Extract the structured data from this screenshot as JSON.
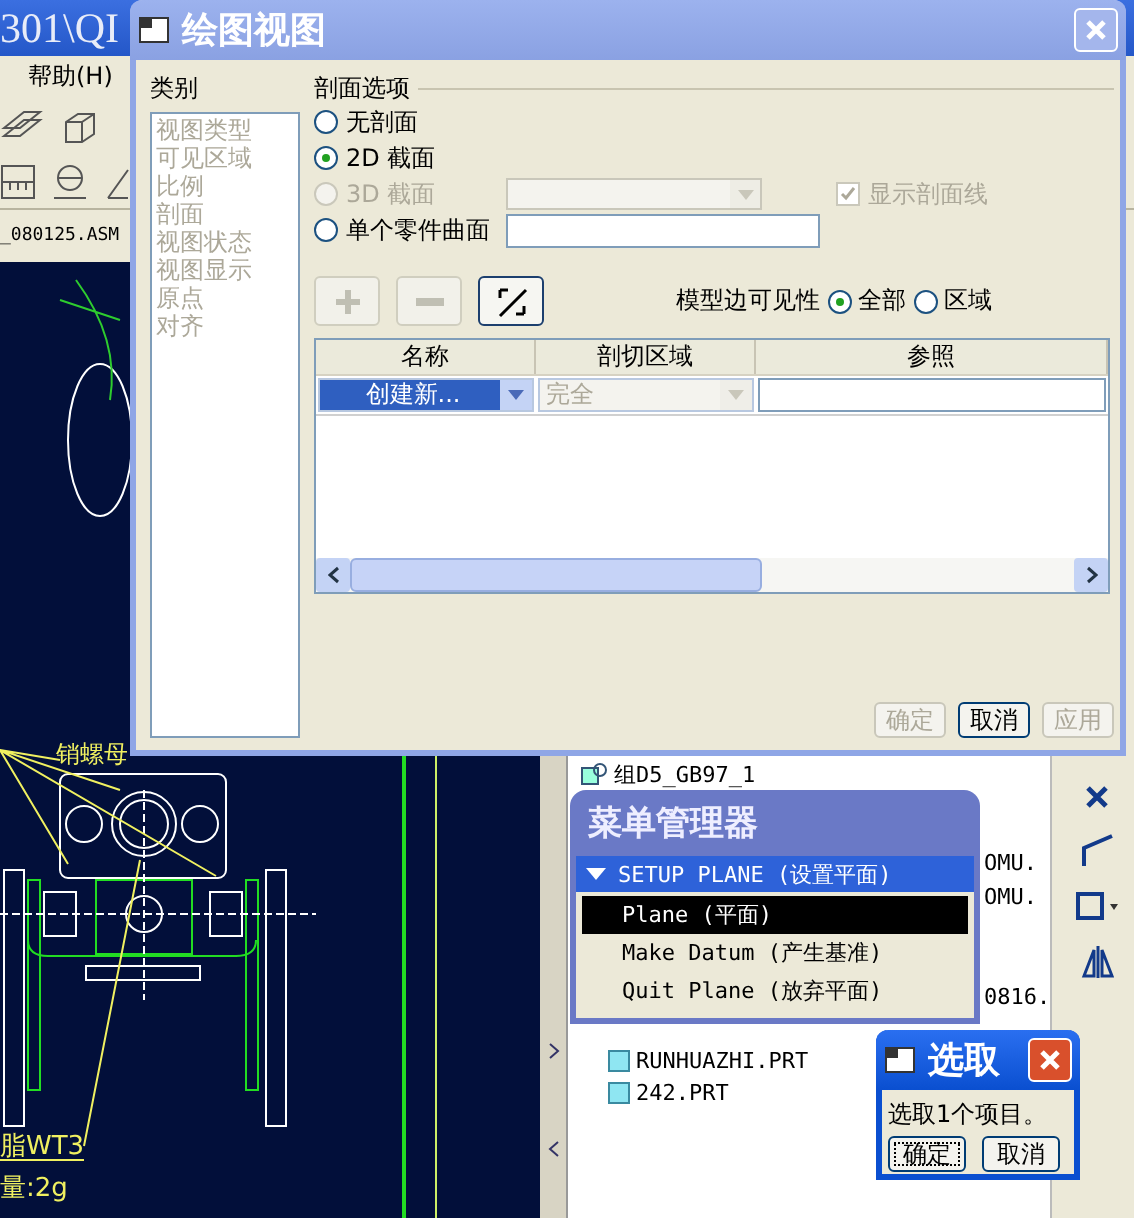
{
  "app": {
    "title": "301\\QI",
    "menu": [
      "帮助(H)"
    ],
    "file_name": "_080125.ASM",
    "drawing_notes": [
      "销螺母",
      "脂WT3",
      "量:2g"
    ],
    "model_tree": [
      {
        "label": "组D5_GB97_1",
        "kind": "group"
      },
      {
        "label": "OMU.",
        "kind": "partial"
      },
      {
        "label": "OMU.",
        "kind": "partial"
      },
      {
        "label": "0816.",
        "kind": "partial"
      },
      {
        "label": "RUNHUAZHI.PRT",
        "kind": "part"
      },
      {
        "label": "242.PRT",
        "kind": "part"
      }
    ]
  },
  "drawing_view_dialog": {
    "title": "绘图视图",
    "categories_label": "类别",
    "categories": [
      {
        "label": "视图类型",
        "disabled": true
      },
      {
        "label": "可见区域",
        "disabled": true
      },
      {
        "label": "比例",
        "disabled": true
      },
      {
        "label": "剖面",
        "disabled": true
      },
      {
        "label": "视图状态",
        "disabled": true
      },
      {
        "label": "视图显示",
        "disabled": true
      },
      {
        "label": "原点",
        "disabled": true
      },
      {
        "label": "对齐",
        "disabled": true
      }
    ],
    "section_options": {
      "title": "剖面选项",
      "options": [
        {
          "label": "无剖面",
          "selected": false,
          "disabled": false,
          "kind": "plain"
        },
        {
          "label": "2D 截面",
          "selected": true,
          "disabled": false,
          "kind": "plain"
        },
        {
          "label": "3D 截面",
          "selected": false,
          "disabled": true,
          "kind": "dropdown"
        },
        {
          "label": "单个零件曲面",
          "selected": false,
          "disabled": false,
          "kind": "text_field"
        }
      ],
      "show_hatching": {
        "label": "显示剖面线",
        "checked": true,
        "disabled": true
      }
    },
    "tool_buttons": [
      {
        "kind": "add",
        "disabled": true
      },
      {
        "kind": "remove",
        "disabled": true
      },
      {
        "kind": "flip",
        "disabled": false
      }
    ],
    "edge_visibility": {
      "label": "模型边可见性",
      "options": [
        {
          "label": "全部",
          "selected": true
        },
        {
          "label": "区域",
          "selected": false
        }
      ]
    },
    "table": {
      "columns": [
        "名称",
        "剖切区域",
        "参照"
      ],
      "rows": [
        {
          "name": "创建新...",
          "name_selected": true,
          "region": "完全",
          "region_disabled": true
        }
      ]
    },
    "buttons": [
      {
        "label": "确定",
        "disabled": true
      },
      {
        "label": "取消",
        "disabled": false
      },
      {
        "label": "应用",
        "disabled": true
      }
    ]
  },
  "menu_manager": {
    "title": "菜单管理器",
    "section": {
      "label": "SETUP PLANE (设置平面)",
      "expanded": true
    },
    "items": [
      {
        "label": "Plane (平面)",
        "selected": true
      },
      {
        "label": "Make Datum (产生基准)",
        "selected": false
      },
      {
        "label": "Quit Plane (放弃平面)",
        "selected": false
      }
    ]
  },
  "select_dialog": {
    "title": "选取",
    "message": "选取1个项目。",
    "buttons": [
      {
        "label": "确定",
        "focused": true
      },
      {
        "label": "取消",
        "focused": false
      }
    ]
  }
}
